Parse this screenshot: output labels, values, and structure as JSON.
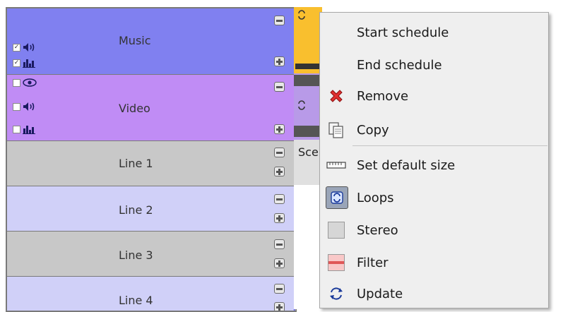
{
  "tracks": [
    {
      "name": "Music",
      "color": "#8080f0"
    },
    {
      "name": "Video",
      "color": "#c08cf5"
    },
    {
      "name": "Line 1",
      "color": "#c8c8c8"
    },
    {
      "name": "Line 2",
      "color": "#d0d0f8"
    },
    {
      "name": "Line 3",
      "color": "#c8c8c8"
    },
    {
      "name": "Line 4",
      "color": "#d0d0f8"
    }
  ],
  "clip_line1_text": "Sce",
  "menu": {
    "start_schedule": "Start schedule",
    "end_schedule": "End schedule",
    "remove": "Remove",
    "copy": "Copy",
    "set_default_size": "Set default size",
    "loops": "Loops",
    "stereo": "Stereo",
    "filter": "Filter",
    "update": "Update"
  },
  "icons": {
    "remove": "red-x-icon",
    "copy": "copy-icon",
    "set_default_size": "ruler-icon",
    "loops": "loop-icon",
    "stereo": "stereo-icon",
    "filter": "filter-icon",
    "update": "update-icon"
  }
}
